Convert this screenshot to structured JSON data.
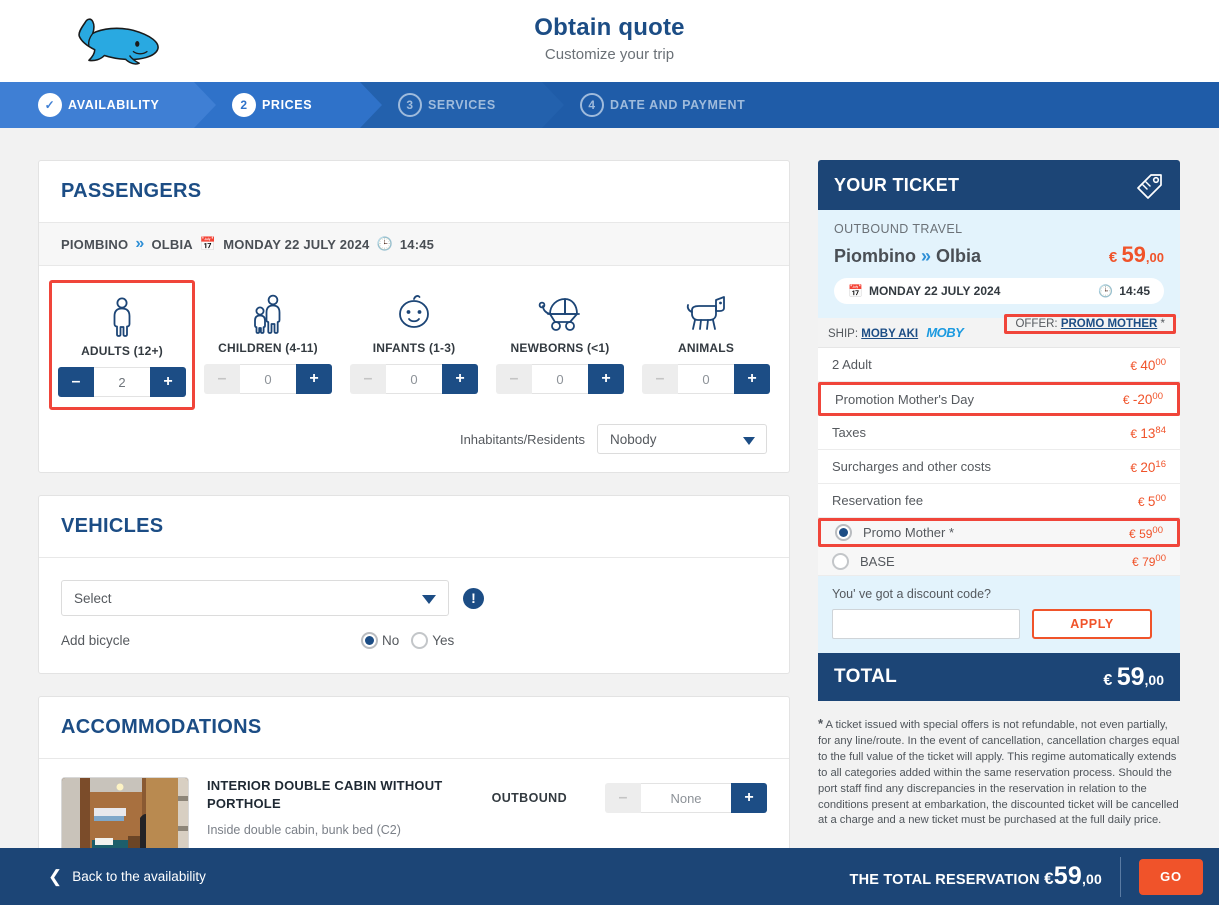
{
  "header": {
    "title": "Obtain quote",
    "subtitle": "Customize your trip",
    "logo_icon": "whale-logo"
  },
  "steps": [
    {
      "num": "✓",
      "label": "AVAILABILITY",
      "state": "completed"
    },
    {
      "num": "2",
      "label": "PRICES",
      "state": "active"
    },
    {
      "num": "3",
      "label": "SERVICES",
      "state": "inactive"
    },
    {
      "num": "4",
      "label": "DATE AND PAYMENT",
      "state": "inactive"
    }
  ],
  "passengers": {
    "title": "PASSENGERS",
    "route": {
      "from": "PIOMBINO",
      "chevron": "»",
      "to": "OLBIA",
      "date": "MONDAY 22 JULY 2024",
      "time": "14:45"
    },
    "types": [
      {
        "label": "ADULTS (12+)",
        "value": "2",
        "icon": "adult-icon",
        "minus_enabled": true,
        "highlighted": true
      },
      {
        "label": "CHILDREN (4-11)",
        "value": "0",
        "icon": "children-icon",
        "minus_enabled": false,
        "highlighted": false
      },
      {
        "label": "INFANTS (1-3)",
        "value": "0",
        "icon": "infant-icon",
        "minus_enabled": false,
        "highlighted": false
      },
      {
        "label": "NEWBORNS (<1)",
        "value": "0",
        "icon": "stroller-icon",
        "minus_enabled": false,
        "highlighted": false
      },
      {
        "label": "ANIMALS",
        "value": "0",
        "icon": "dog-icon",
        "minus_enabled": false,
        "highlighted": false
      }
    ],
    "residents_label": "Inhabitants/Residents",
    "residents_value": "Nobody"
  },
  "vehicles": {
    "title": "VEHICLES",
    "select_placeholder": "Select",
    "info_icon": "exclamation-icon",
    "bicycle_label": "Add bicycle",
    "bicycle_options": [
      {
        "label": "No",
        "selected": true
      },
      {
        "label": "Yes",
        "selected": false
      }
    ]
  },
  "accommodations": {
    "title": "ACCOMMODATIONS",
    "items": [
      {
        "name": "INTERIOR DOUBLE CABIN WITHOUT PORTHOLE",
        "description": "Inside double cabin, bunk bed (C2)",
        "direction": "OUTBOUND",
        "quantity": "None"
      }
    ]
  },
  "ticket": {
    "title": "YOUR TICKET",
    "tag_icon": "price-tag-icon",
    "outbound_label": "OUTBOUND TRAVEL",
    "route_from": "Piombino",
    "route_chevron": "»",
    "route_to": "Olbia",
    "route_price": {
      "currency": "€",
      "amount": "59",
      "cents": ",00"
    },
    "date": "MONDAY 22 JULY 2024",
    "time": "14:45",
    "ship_label": "SHIP:",
    "ship_name": "MOBY AKI",
    "ship_brand": "MOBY",
    "offer_label": "OFFER:",
    "offer_name": "PROMO MOTHER",
    "offer_star": "*",
    "lines": [
      {
        "label": "2 Adult",
        "currency": "€",
        "amount": "40",
        "cents": "00",
        "highlighted": false
      },
      {
        "label": "Promotion Mother's Day",
        "currency": "€",
        "amount": "-20",
        "cents": "00",
        "highlighted": true
      },
      {
        "label": "Taxes",
        "currency": "€",
        "amount": "13",
        "cents": "84",
        "highlighted": false
      },
      {
        "label": "Surcharges and other costs",
        "currency": "€",
        "amount": "20",
        "cents": "16",
        "highlighted": false
      },
      {
        "label": "Reservation fee",
        "currency": "€",
        "amount": "5",
        "cents": "00",
        "highlighted": false
      }
    ],
    "fare_options": [
      {
        "label": "Promo Mother *",
        "currency": "€",
        "amount": "59",
        "cents": "00",
        "selected": true,
        "highlighted": true
      },
      {
        "label": "BASE",
        "currency": "€",
        "amount": "79",
        "cents": "00",
        "selected": false,
        "highlighted": false
      }
    ],
    "discount_question": "You' ve got a discount code?",
    "discount_value": "",
    "discount_placeholder": "",
    "apply_label": "APPLY",
    "total_label": "TOTAL",
    "total_price": {
      "currency": "€",
      "amount": "59",
      "cents": ",00"
    },
    "disclaimer_star": "*",
    "disclaimer": " A ticket issued with special offers is not refundable, not even partially, for any line/route. In the event of cancellation, cancellation charges equal to the full value of the ticket will apply. This regime automatically extends to all categories added within the same reservation process. Should the port staff find any discrepancies in the reservation in relation to the conditions present at embarkation, the discounted ticket will be cancelled at a charge and a new ticket must be purchased at the full daily price."
  },
  "bottom": {
    "back_label": "Back to the availability",
    "back_icon": "chevron-left-icon",
    "total_label": "THE TOTAL RESERVATION",
    "total_currency": "€",
    "total_amount": "59",
    "total_cents": ",00",
    "go_label": "GO"
  },
  "colors": {
    "brand_blue": "#1c4576",
    "accent_orange": "#f0532a",
    "highlight_red": "#f0453a",
    "step_active": "#2f72c9",
    "light_blue_bg": "#e3f3fc"
  }
}
